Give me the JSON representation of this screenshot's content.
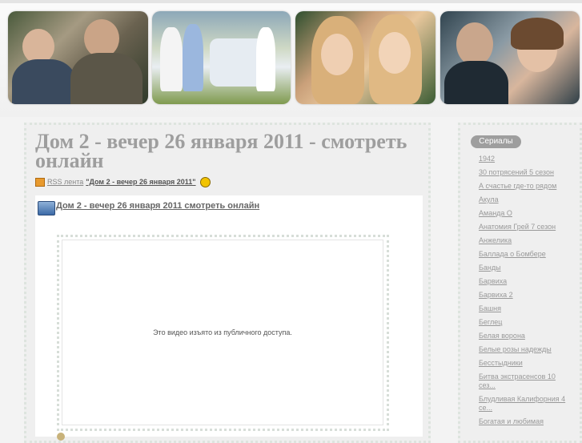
{
  "banner": {
    "photos": [
      {
        "name": "banner-photo-1-icon"
      },
      {
        "name": "banner-photo-2-icon"
      },
      {
        "name": "banner-photo-3-icon"
      },
      {
        "name": "banner-photo-4-icon"
      }
    ]
  },
  "post": {
    "title": "Дом 2 - вечер 26 января 2011 - смотреть онлайн",
    "rss_label": "RSS лента",
    "rss_quote": "\"Дом 2 - вечер 26 января 2011\"",
    "inner_title": "Дом 2 - вечер 26 января 2011 смотреть онлайн",
    "video_message": "Это видео изъято из публичного доступа."
  },
  "sidebar": {
    "heading": "Сериалы",
    "items": [
      "1942",
      "30 потрясений 5 сезон",
      "А счастье где-то рядом",
      "Акула",
      "Аманда О",
      "Анатомия Грей 7 сезон",
      "Анжелика",
      "Баллада о Бомбере",
      "Банды",
      "Барвиха",
      "Барвиха 2",
      "Башня",
      "Беглец",
      "Белая ворона",
      "Белые розы надежды",
      "Бесстыдники",
      "Битва экстрасенсов 10 сез...",
      "Блудливая Калифорния 4 се...",
      "Богатая и любимая"
    ]
  },
  "colors": {
    "title": "#9e9e9e",
    "sidebar_heading_bg": "#9e9e9e",
    "link": "#999999"
  }
}
